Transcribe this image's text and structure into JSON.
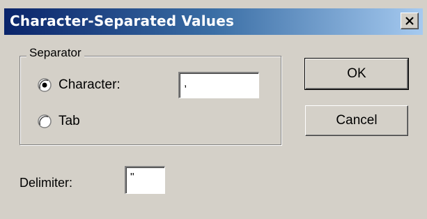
{
  "window": {
    "title": "Character-Separated Values",
    "close_icon": "close-icon"
  },
  "separator": {
    "legend": "Separator",
    "options": [
      {
        "label": "Character:",
        "selected": true
      },
      {
        "label": "Tab",
        "selected": false
      }
    ],
    "character_value": ","
  },
  "delimiter": {
    "label": "Delimiter:",
    "value": "\""
  },
  "buttons": {
    "ok_label": "OK",
    "cancel_label": "Cancel"
  },
  "colors": {
    "dialog_face": "#d4d0c8",
    "titlebar_start": "#0a246a",
    "titlebar_end": "#a6caf0"
  }
}
